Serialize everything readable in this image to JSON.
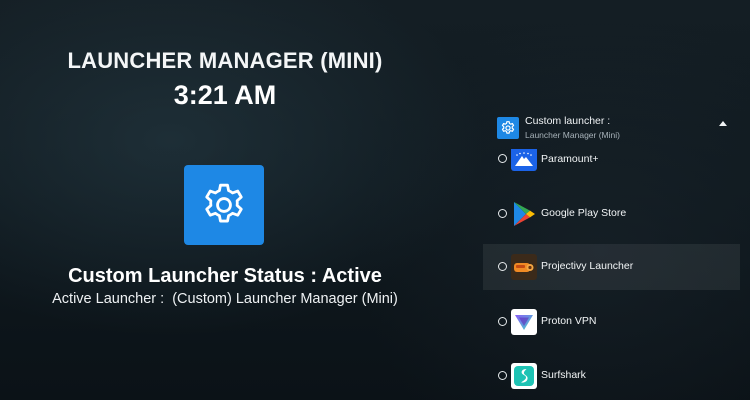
{
  "app": {
    "title": "LAUNCHER MANAGER (MINI)",
    "time": "3:21 AM",
    "icon": "gear-icon",
    "status": "Custom Launcher Status : Active",
    "active_launcher": "Active Launcher :  (Custom) Launcher Manager (Mini)"
  },
  "launcher_list": {
    "header": {
      "title": "Custom launcher :",
      "subtitle": "Launcher Manager (Mini)",
      "icon": "gear-icon"
    },
    "items": [
      {
        "label": "Paramount+",
        "icon": "paramount-icon",
        "selected": false
      },
      {
        "label": "Google Play Store",
        "icon": "google-play-icon",
        "selected": false
      },
      {
        "label": "Projectivy Launcher",
        "icon": "projectivy-icon",
        "selected": false,
        "focused": true
      },
      {
        "label": "Proton VPN",
        "icon": "proton-vpn-icon",
        "selected": false
      },
      {
        "label": "Surfshark",
        "icon": "surfshark-icon",
        "selected": false
      }
    ]
  },
  "colors": {
    "accent": "#1e88e5",
    "background": "#111b21",
    "text": "#ffffff"
  }
}
